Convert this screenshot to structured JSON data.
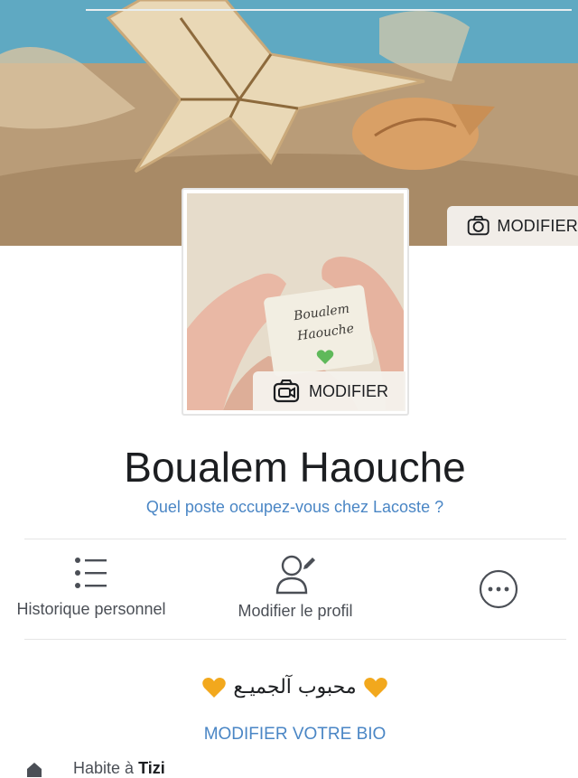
{
  "cover": {
    "edit_label": "MODIFIER",
    "edit_icon": "camera-icon"
  },
  "avatar": {
    "image_text_line1": "Boualem",
    "image_text_line2": "Haouche",
    "edit_label": "MODIFIER",
    "edit_icon": "video-camera-icon"
  },
  "profile": {
    "name": "Boualem Haouche",
    "job_prompt": "Quel poste occupez-vous chez Lacoste ?"
  },
  "actions": [
    {
      "label": "Historique personnel",
      "icon": "list-icon"
    },
    {
      "label": "Modifier le profil",
      "icon": "edit-profile-icon"
    },
    {
      "label": "",
      "icon": "more-icon"
    }
  ],
  "bio": {
    "text": "محبوب آلجميـع",
    "heart_color": "#f2a81d",
    "edit_label": "MODIFIER VOTRE BIO"
  },
  "intro": {
    "lives_prefix": "Habite à",
    "lives_city": "Tizi"
  },
  "colors": {
    "link": "#4a86c5",
    "text": "#1c1e21",
    "muted": "#4b4f56"
  }
}
